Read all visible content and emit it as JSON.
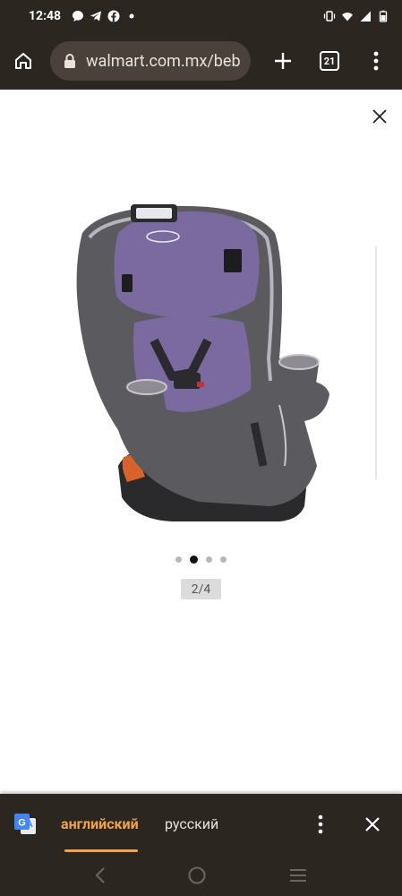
{
  "status_bar": {
    "time": "12:48",
    "left_icons": [
      "chat-icon",
      "telegram-icon",
      "facebook-icon",
      "dot-icon"
    ],
    "right_icons": [
      "vibrate-icon",
      "wifi-icon",
      "signal-icon",
      "battery-icon"
    ]
  },
  "toolbar": {
    "url": "walmart.com.mx/beb",
    "tab_count": "21",
    "icons": [
      "home-icon",
      "lock-icon",
      "new-tab-icon",
      "tab-switcher-icon",
      "menu-icon"
    ]
  },
  "viewer": {
    "image_alt": "Graco car seat, purple",
    "counter": "2/4",
    "total": 4,
    "active_index": 1,
    "close_icon": "close-icon"
  },
  "translate": {
    "source_lang": "английский",
    "target_lang": "русский",
    "active_tab": "source",
    "accent_color": "#f0a44a"
  },
  "colors": {
    "chrome": "#2b2620",
    "url_bg": "#4a413a",
    "seat_purple": "#7b6aa0",
    "seat_grey": "#5b5a5e"
  }
}
